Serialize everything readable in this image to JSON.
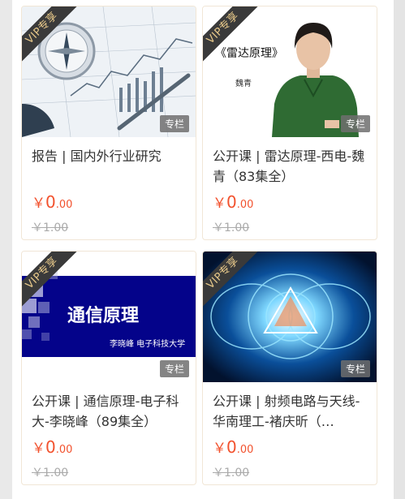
{
  "cards": [
    {
      "vip_label": "VIP专享",
      "tag": "专栏",
      "title": "报告 | 国内外行业研究",
      "price_currency": "￥",
      "price_int": "0",
      "price_dec": ".00",
      "original_price": "￥1.00"
    },
    {
      "vip_label": "VIP专享",
      "tag": "专栏",
      "title": "公开课 | 雷达原理-西电-魏青（83集全）",
      "price_currency": "￥",
      "price_int": "0",
      "price_dec": ".00",
      "original_price": "￥1.00",
      "thumb_text": "《雷达原理》",
      "thumb_name": "魏青"
    },
    {
      "vip_label": "VIP专享",
      "tag": "专栏",
      "title": "公开课 | 通信原理-电子科大-李晓峰（89集全）",
      "price_currency": "￥",
      "price_int": "0",
      "price_dec": ".00",
      "original_price": "￥1.00",
      "thumb_text": "通信原理",
      "thumb_sub": "李晓峰 电子科技大学"
    },
    {
      "vip_label": "VIP专享",
      "tag": "专栏",
      "title": "公开课 | 射频电路与天线-华南理工-褚庆昕（…",
      "price_currency": "￥",
      "price_int": "0",
      "price_dec": ".00",
      "original_price": "￥1.00"
    }
  ],
  "colors": {
    "price": "#f2522e",
    "vip_ribbon_bg": "#3a3a3a",
    "vip_ribbon_text": "#e8c98a",
    "card_border": "#f1e6d6"
  }
}
